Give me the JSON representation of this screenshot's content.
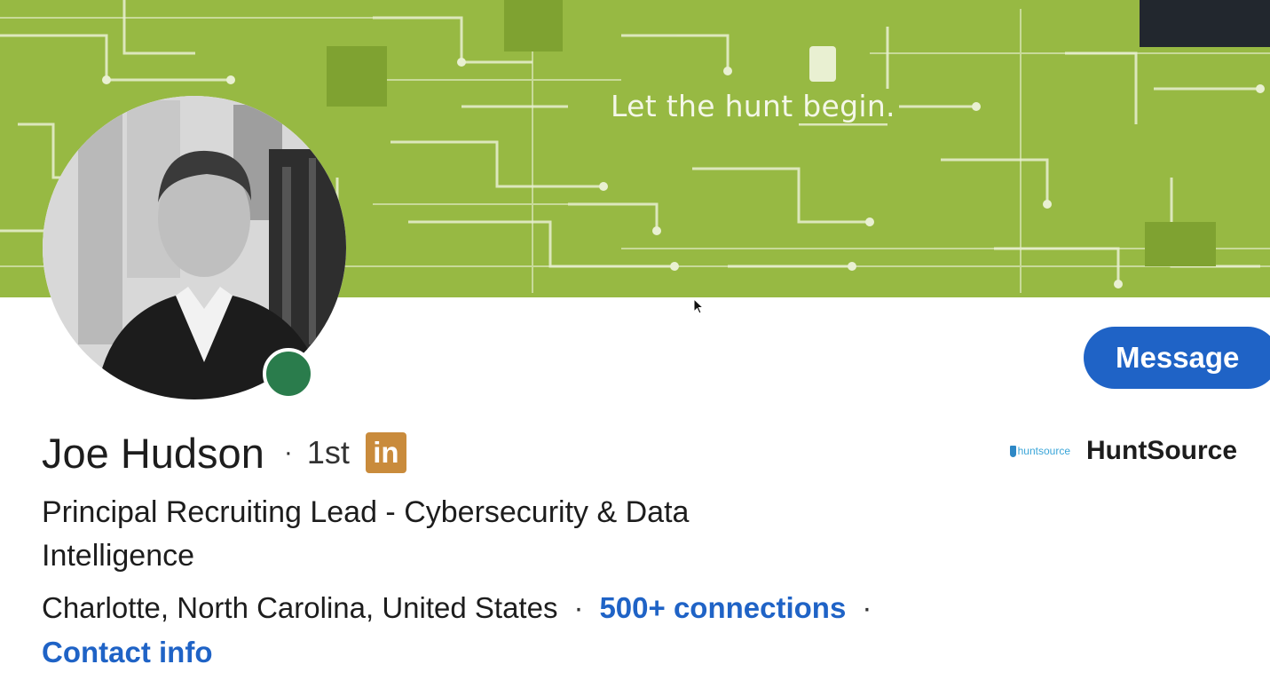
{
  "banner": {
    "tagline": "Let the hunt begin."
  },
  "profile": {
    "name": "Joe Hudson",
    "separator": "·",
    "degree": "1st",
    "premium_badge": "in",
    "headline": "Principal Recruiting Lead - Cybersecurity & Data Intelligence",
    "location": "Charlotte, North Carolina, United States",
    "connections": "500+ connections",
    "contact_info": "Contact info"
  },
  "company": {
    "logo_text": "huntsource",
    "name": "HuntSource"
  },
  "actions": {
    "message_label": "Message"
  },
  "icons": {
    "presence": "online-status-icon",
    "badge": "linkedin-icon",
    "cursor": "mouse-pointer-icon"
  },
  "colors": {
    "banner": "#97b943",
    "link": "#1f63c6",
    "online": "#2a7c4c",
    "badge": "#c98b3c"
  }
}
